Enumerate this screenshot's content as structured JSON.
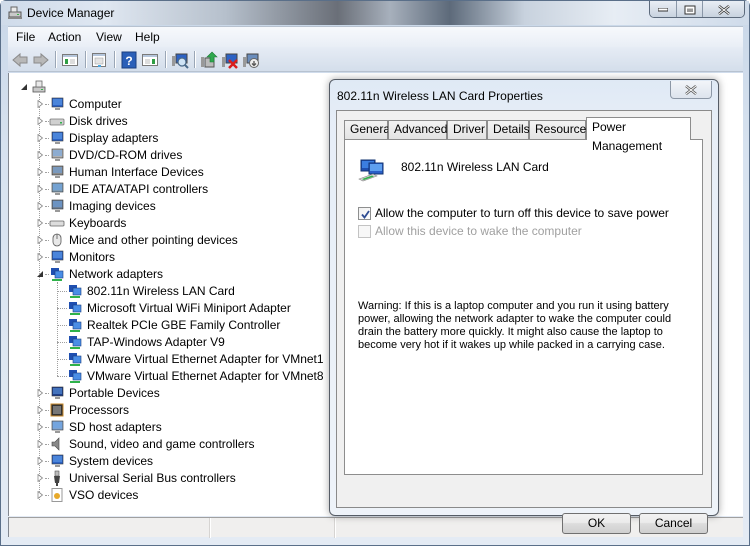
{
  "window": {
    "title": "Device Manager",
    "caption_buttons": [
      "minimize-icon",
      "maximize-icon",
      "close-icon"
    ]
  },
  "menubar": {
    "items": [
      "File",
      "Action",
      "View",
      "Help"
    ]
  },
  "toolbar": {
    "buttons": [
      "back-arrow-icon",
      "forward-arrow-icon",
      "show-hide-console-tree-icon",
      "properties-icon",
      "help-icon",
      "show-action-pane-icon",
      "scan-hardware-changes-icon",
      "update-driver-icon",
      "uninstall-icon",
      "disable-device-icon"
    ]
  },
  "tree": {
    "root": {
      "icon": "computer-root-icon",
      "expanded": true
    },
    "items": [
      {
        "label": "Computer",
        "icon": "computer-icon",
        "expanded": false
      },
      {
        "label": "Disk drives",
        "icon": "disk-drive-icon",
        "expanded": false
      },
      {
        "label": "Display adapters",
        "icon": "display-adapter-icon",
        "expanded": false
      },
      {
        "label": "DVD/CD-ROM drives",
        "icon": "dvd-drive-icon",
        "expanded": false
      },
      {
        "label": "Human Interface Devices",
        "icon": "hid-icon",
        "expanded": false
      },
      {
        "label": "IDE ATA/ATAPI controllers",
        "icon": "ide-controller-icon",
        "expanded": false
      },
      {
        "label": "Imaging devices",
        "icon": "imaging-device-icon",
        "expanded": false
      },
      {
        "label": "Keyboards",
        "icon": "keyboard-icon",
        "expanded": false
      },
      {
        "label": "Mice and other pointing devices",
        "icon": "mouse-icon",
        "expanded": false
      },
      {
        "label": "Monitors",
        "icon": "monitor-icon",
        "expanded": false
      },
      {
        "label": "Network adapters",
        "icon": "network-adapter-icon",
        "expanded": true,
        "children": [
          "802.11n Wireless LAN Card",
          "Microsoft Virtual WiFi Miniport Adapter",
          "Realtek PCIe GBE Family Controller",
          "TAP-Windows Adapter V9",
          "VMware Virtual Ethernet Adapter for VMnet1",
          "VMware Virtual Ethernet Adapter for VMnet8"
        ]
      },
      {
        "label": "Portable Devices",
        "icon": "portable-device-icon",
        "expanded": false
      },
      {
        "label": "Processors",
        "icon": "processor-icon",
        "expanded": false
      },
      {
        "label": "SD host adapters",
        "icon": "sd-host-adapter-icon",
        "expanded": false
      },
      {
        "label": "Sound, video and game controllers",
        "icon": "speaker-icon",
        "expanded": false
      },
      {
        "label": "System devices",
        "icon": "system-device-icon",
        "expanded": false
      },
      {
        "label": "Universal Serial Bus controllers",
        "icon": "usb-icon",
        "expanded": false
      },
      {
        "label": "VSO devices",
        "icon": "vso-device-icon",
        "expanded": false
      }
    ]
  },
  "dialog": {
    "title": "802.11n Wireless LAN Card Properties",
    "tabs": [
      "General",
      "Advanced",
      "Driver",
      "Details",
      "Resources",
      "Power Management"
    ],
    "active_tab": "Power Management",
    "device_name": "802.11n Wireless LAN Card",
    "options": [
      {
        "label": "Allow the computer to turn off this device to save power",
        "checked": true,
        "enabled": true
      },
      {
        "label": "Allow this device to wake the computer",
        "checked": false,
        "enabled": false
      }
    ],
    "warning": "Warning: If this is a laptop computer and you run it using battery power, allowing the network adapter to wake the computer could drain the battery more quickly. It might also cause the laptop to become very hot if it wakes up while packed in a carrying case.",
    "ok_label": "OK",
    "cancel_label": "Cancel"
  }
}
